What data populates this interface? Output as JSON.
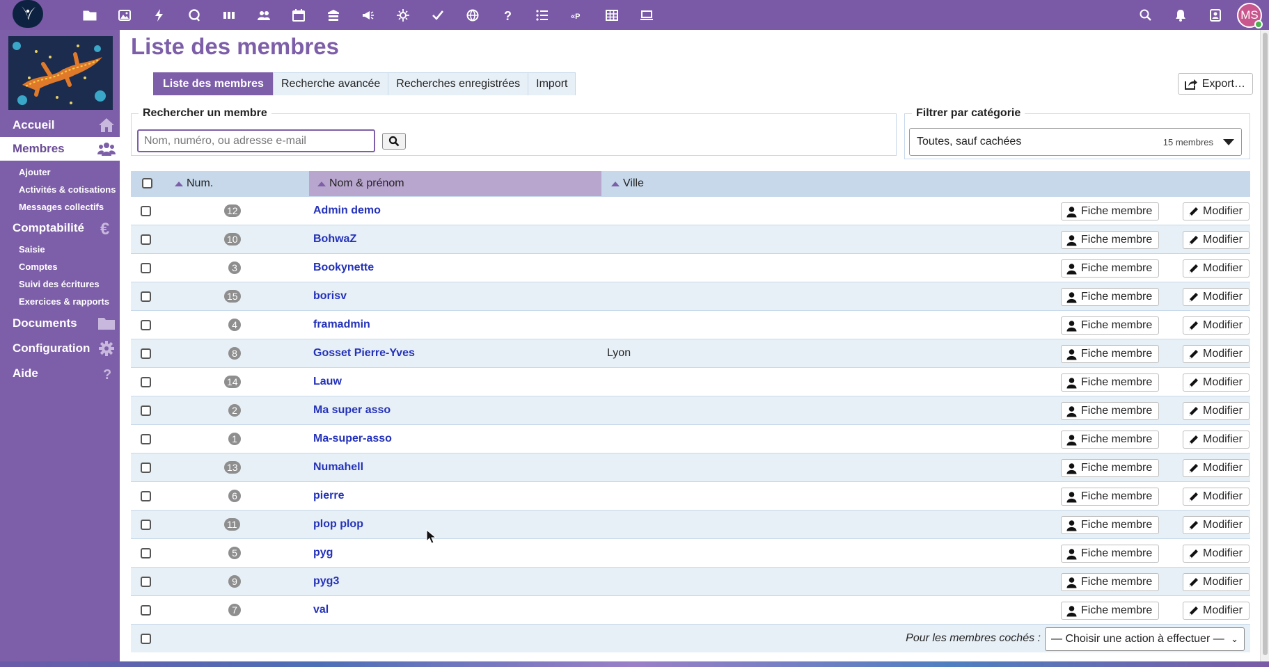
{
  "topbar": {
    "app_icons": [
      "folder-icon",
      "image-icon",
      "bolt-icon",
      "chat-icon",
      "deck-icon",
      "contacts-icon",
      "calendar-icon",
      "collectives-icon",
      "announcements-icon",
      "activity-icon",
      "tasks-icon",
      "globe-icon",
      "help-icon",
      "list-icon",
      "garradin-icon",
      "table-icon",
      "laptop-icon"
    ],
    "avatar_initials": "MS"
  },
  "sidebar": {
    "accueil": "Accueil",
    "membres": "Membres",
    "membres_sub": [
      "Ajouter",
      "Activités & cotisations",
      "Messages collectifs"
    ],
    "comptabilite": "Comptabilité",
    "comptabilite_sub": [
      "Saisie",
      "Comptes",
      "Suivi des écritures",
      "Exercices & rapports"
    ],
    "documents": "Documents",
    "configuration": "Configuration",
    "aide": "Aide"
  },
  "page": {
    "title": "Liste des membres",
    "tabs": [
      "Liste des membres",
      "Recherche avancée",
      "Recherches enregistrées",
      "Import"
    ],
    "export_label": "Export…"
  },
  "search": {
    "legend": "Rechercher un membre",
    "placeholder": "Nom, numéro, ou adresse e-mail"
  },
  "filter": {
    "legend": "Filtrer par catégorie",
    "selected": "Toutes, sauf cachées",
    "count": "15 membres"
  },
  "table": {
    "headers": {
      "num": "Num.",
      "name": "Nom & prénom",
      "city": "Ville"
    },
    "fiche_label": "Fiche membre",
    "modifier_label": "Modifier",
    "rows": [
      {
        "num": "12",
        "name": "Admin demo",
        "city": ""
      },
      {
        "num": "10",
        "name": "BohwaZ",
        "city": ""
      },
      {
        "num": "3",
        "name": "Bookynette",
        "city": ""
      },
      {
        "num": "15",
        "name": "borisv",
        "city": ""
      },
      {
        "num": "4",
        "name": "framadmin",
        "city": ""
      },
      {
        "num": "8",
        "name": "Gosset Pierre-Yves",
        "city": "Lyon"
      },
      {
        "num": "14",
        "name": "Lauw",
        "city": ""
      },
      {
        "num": "2",
        "name": "Ma super asso",
        "city": ""
      },
      {
        "num": "1",
        "name": "Ma-super-asso",
        "city": ""
      },
      {
        "num": "13",
        "name": "Numahell",
        "city": ""
      },
      {
        "num": "6",
        "name": "pierre",
        "city": ""
      },
      {
        "num": "11",
        "name": "plop plop",
        "city": ""
      },
      {
        "num": "5",
        "name": "pyg",
        "city": ""
      },
      {
        "num": "9",
        "name": "pyg3",
        "city": ""
      },
      {
        "num": "7",
        "name": "val",
        "city": ""
      }
    ],
    "footer_label": "Pour les membres cochés :",
    "footer_action": "— Choisir une action à effectuer —"
  },
  "colors": {
    "brand": "#7d5ea8",
    "link": "#2432b8",
    "row_alt": "#e8f0f7",
    "header_bg": "#c6d8ea"
  }
}
